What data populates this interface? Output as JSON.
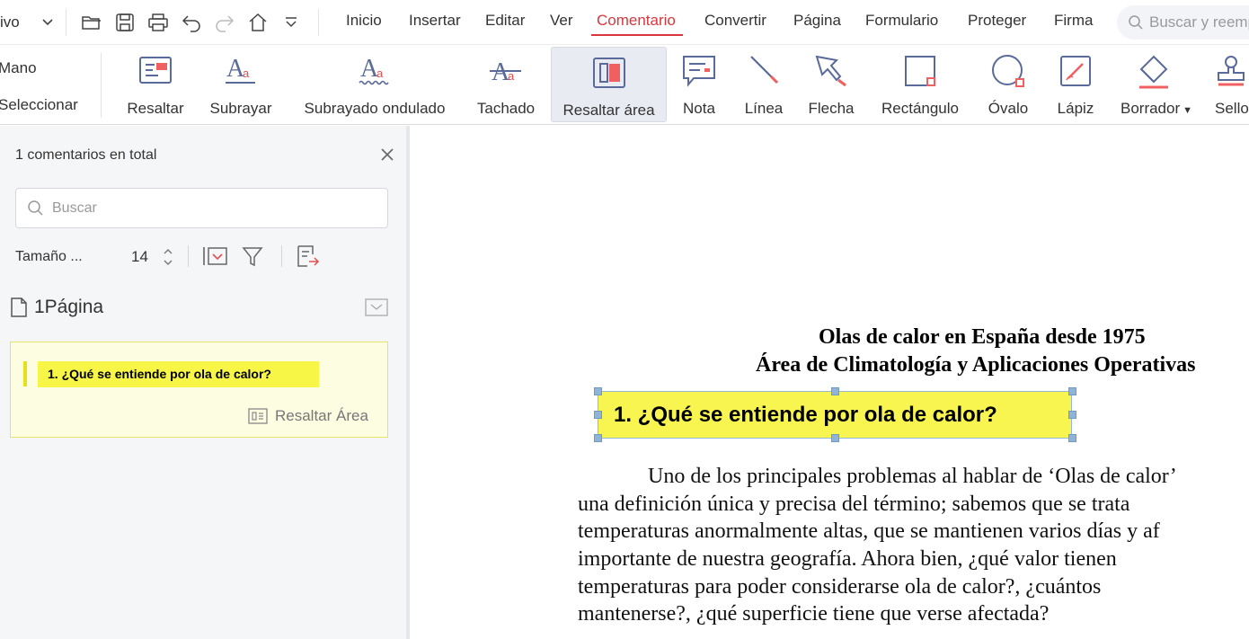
{
  "menubar": {
    "file_menu": "ivo",
    "tabs": [
      "Inicio",
      "Insertar",
      "Editar",
      "Ver",
      "Comentario",
      "Convertir",
      "Página",
      "Formulario",
      "Proteger",
      "Firma"
    ],
    "active_tab": "Comentario",
    "search_placeholder": "Buscar y reemplazar"
  },
  "ribbon": {
    "left_tools": [
      "Mano",
      "Seleccionar"
    ],
    "tools": [
      "Resaltar",
      "Subrayar",
      "Subrayado ondulado",
      "Tachado",
      "Resaltar área",
      "Nota",
      "Línea",
      "Flecha",
      "Rectángulo",
      "Óvalo",
      "Lápiz",
      "Borrador",
      "Sello"
    ],
    "selected_tool": "Resaltar área"
  },
  "panel": {
    "count_text": "1 comentarios en total",
    "search_placeholder": "Buscar",
    "size_label": "Tamaño ...",
    "size_value": "14",
    "page_label": "1Página",
    "comment": {
      "quote": "1.  ¿Qué se entiende por ola de calor?",
      "type": "Resaltar Área"
    }
  },
  "document": {
    "title_1": "Olas de calor en España desde 1975",
    "title_2": "Área de Climatología y Aplicaciones Operativas",
    "highlighted_heading": "1.  ¿Qué se entiende por ola de calor?",
    "paragraph_lines": [
      "Uno de los principales problemas al hablar de ‘Olas de calor’",
      "una definición única y precisa del término; sabemos que se trata",
      "temperaturas anormalmente altas, que se mantienen varios días y af",
      "importante de nuestra geografía. Ahora bien, ¿qué valor tienen",
      "temperaturas para poder considerarse ola de calor?, ¿cuántos",
      "mantenerse?, ¿qué superficie tiene que verse afectada?"
    ]
  },
  "colors": {
    "accent": "#d9363e",
    "highlight": "#f9f550",
    "comment_card_bg": "#fdfde2"
  }
}
